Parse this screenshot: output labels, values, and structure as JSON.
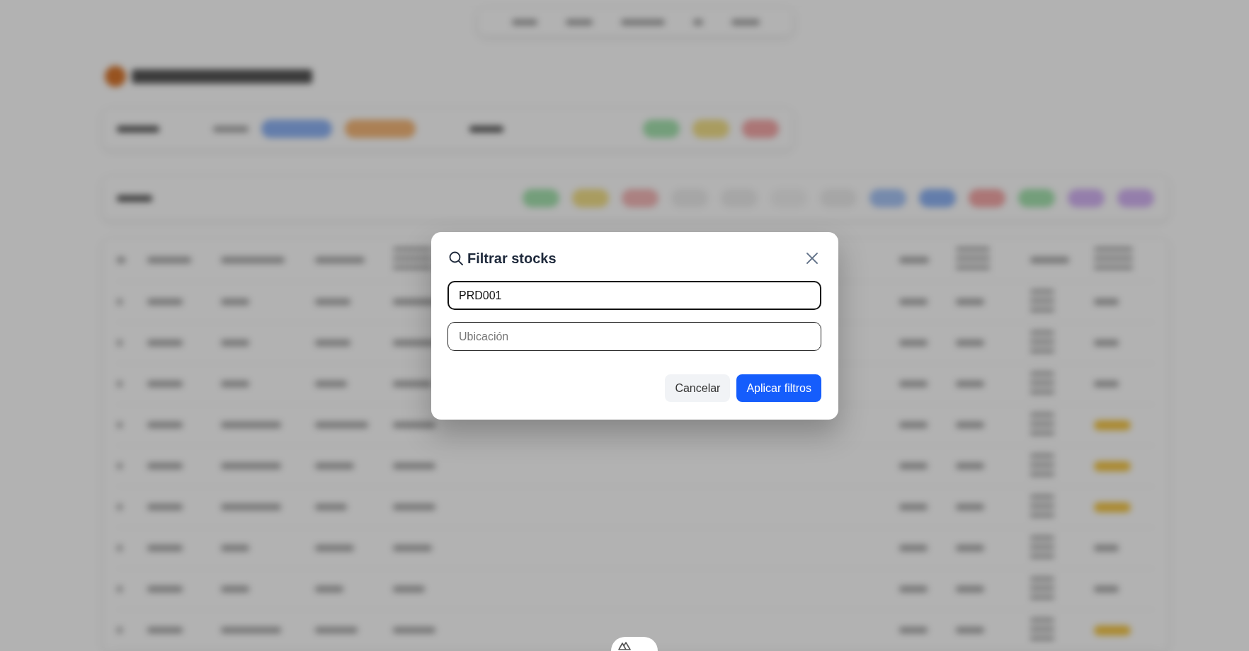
{
  "dialog": {
    "title": "Filtrar stocks",
    "fields": [
      {
        "value": "PRD001",
        "focused": true
      },
      {
        "placeholder": "Ubicación",
        "focused": false
      }
    ],
    "buttons": [
      {
        "label": "Cancelar",
        "kind": "secondary"
      },
      {
        "label": "Aplicar filtros",
        "kind": "primary"
      }
    ]
  }
}
